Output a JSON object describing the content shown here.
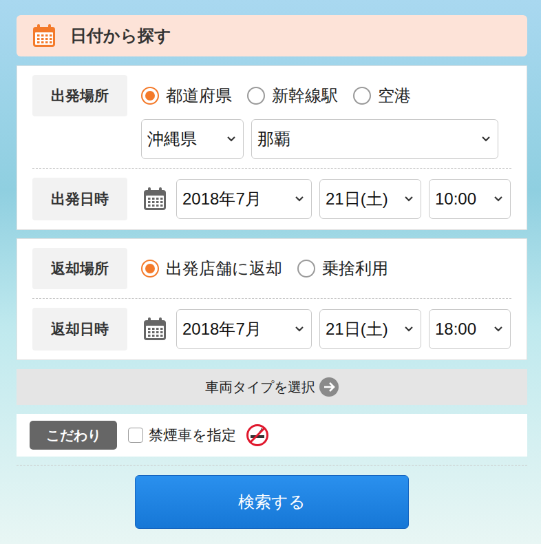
{
  "header": {
    "title": "日付から探す"
  },
  "departure_place": {
    "label": "出発場所",
    "options": [
      {
        "label": "都道府県",
        "selected": true
      },
      {
        "label": "新幹線駅",
        "selected": false
      },
      {
        "label": "空港",
        "selected": false
      }
    ],
    "prefecture": "沖縄県",
    "area": "那覇"
  },
  "departure_datetime": {
    "label": "出発日時",
    "month": "2018年7月",
    "day": "21日(土)",
    "time": "10:00"
  },
  "return_place": {
    "label": "返却場所",
    "options": [
      {
        "label": "出発店舗に返却",
        "selected": true
      },
      {
        "label": "乗捨利用",
        "selected": false
      }
    ]
  },
  "return_datetime": {
    "label": "返却日時",
    "month": "2018年7月",
    "day": "21日(土)",
    "time": "18:00"
  },
  "vehicle_type": {
    "label": "車両タイプを選択"
  },
  "preferences": {
    "badge": "こだわり",
    "options": [
      {
        "label": "禁煙車を指定",
        "checked": false
      }
    ]
  },
  "search_button": {
    "label": "検索する"
  }
}
